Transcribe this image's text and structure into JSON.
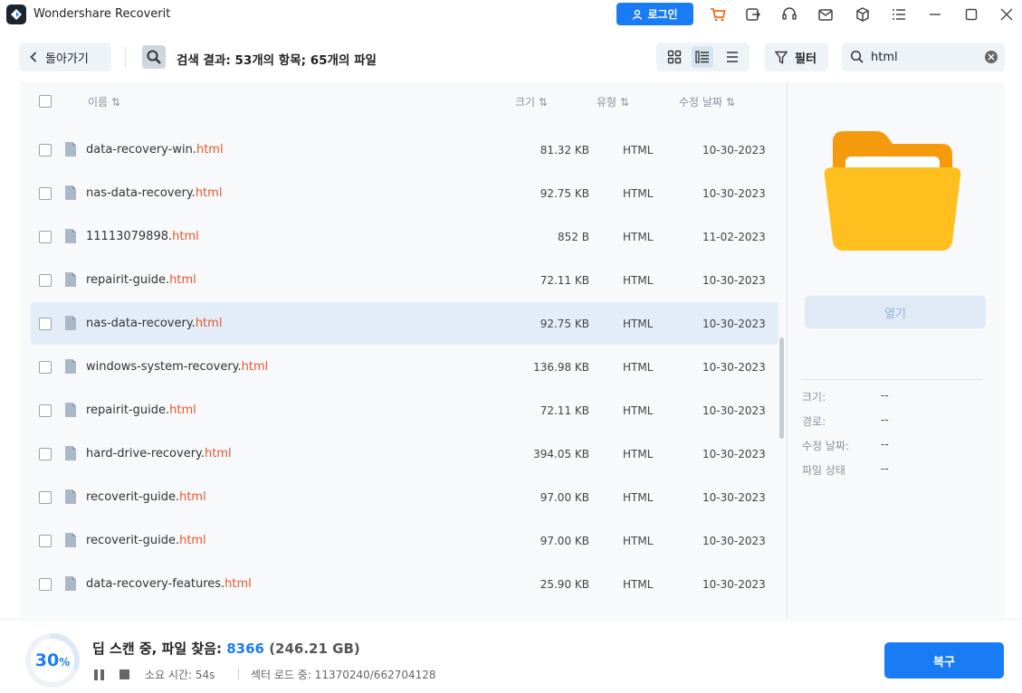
{
  "app": {
    "title": "Wondershare Recoverit"
  },
  "titlebar": {
    "login_label": "로그인"
  },
  "toolbar": {
    "back_label": "돌아가기",
    "search_result": "검색 결과: 53개의 항목; 65개의 파일",
    "filter_label": "필터",
    "search_value": "html"
  },
  "list": {
    "headers": {
      "name": "이름",
      "size": "크기",
      "type": "유형",
      "date": "수정 날짜"
    },
    "rows": [
      {
        "base": "data-recovery-win.",
        "ext": "html",
        "size": "81.32 KB",
        "type": "HTML",
        "date": "10-30-2023",
        "selected": false
      },
      {
        "base": "nas-data-recovery.",
        "ext": "html",
        "size": "92.75 KB",
        "type": "HTML",
        "date": "10-30-2023",
        "selected": false
      },
      {
        "base": "11113079898.",
        "ext": "html",
        "size": "852 B",
        "type": "HTML",
        "date": "11-02-2023",
        "selected": false
      },
      {
        "base": "repairit-guide.",
        "ext": "html",
        "size": "72.11 KB",
        "type": "HTML",
        "date": "10-30-2023",
        "selected": false
      },
      {
        "base": "nas-data-recovery.",
        "ext": "html",
        "size": "92.75 KB",
        "type": "HTML",
        "date": "10-30-2023",
        "selected": true
      },
      {
        "base": "windows-system-recovery.",
        "ext": "html",
        "size": "136.98 KB",
        "type": "HTML",
        "date": "10-30-2023",
        "selected": false
      },
      {
        "base": "repairit-guide.",
        "ext": "html",
        "size": "72.11 KB",
        "type": "HTML",
        "date": "10-30-2023",
        "selected": false
      },
      {
        "base": "hard-drive-recovery.",
        "ext": "html",
        "size": "394.05 KB",
        "type": "HTML",
        "date": "10-30-2023",
        "selected": false
      },
      {
        "base": "recoverit-guide.",
        "ext": "html",
        "size": "97.00 KB",
        "type": "HTML",
        "date": "10-30-2023",
        "selected": false
      },
      {
        "base": "recoverit-guide.",
        "ext": "html",
        "size": "97.00 KB",
        "type": "HTML",
        "date": "10-30-2023",
        "selected": false
      },
      {
        "base": "data-recovery-features.",
        "ext": "html",
        "size": "25.90 KB",
        "type": "HTML",
        "date": "10-30-2023",
        "selected": false
      }
    ]
  },
  "preview": {
    "open_label": "열기",
    "props": [
      {
        "label": "크기:",
        "value": "--"
      },
      {
        "label": "경로:",
        "value": "--"
      },
      {
        "label": "수정 날짜:",
        "value": "--"
      },
      {
        "label": "파일 상태",
        "value": "--"
      }
    ]
  },
  "bottom": {
    "progress_number": "30",
    "progress_unit": "%",
    "progress_fraction": 0.3,
    "status_prefix": "딥 스캔 중, 파일 찾음: ",
    "found_count": "8366",
    "found_size": " (246.21 GB)",
    "elapsed": "소요 시간: 54s",
    "sector": "섹터 로드 중: 11370240/662704128",
    "recover_label": "복구"
  },
  "colors": {
    "accent": "#1a7cf4",
    "extension": "#e8542c",
    "selected_row": "#e3edf8",
    "folder": "#ffb800"
  }
}
